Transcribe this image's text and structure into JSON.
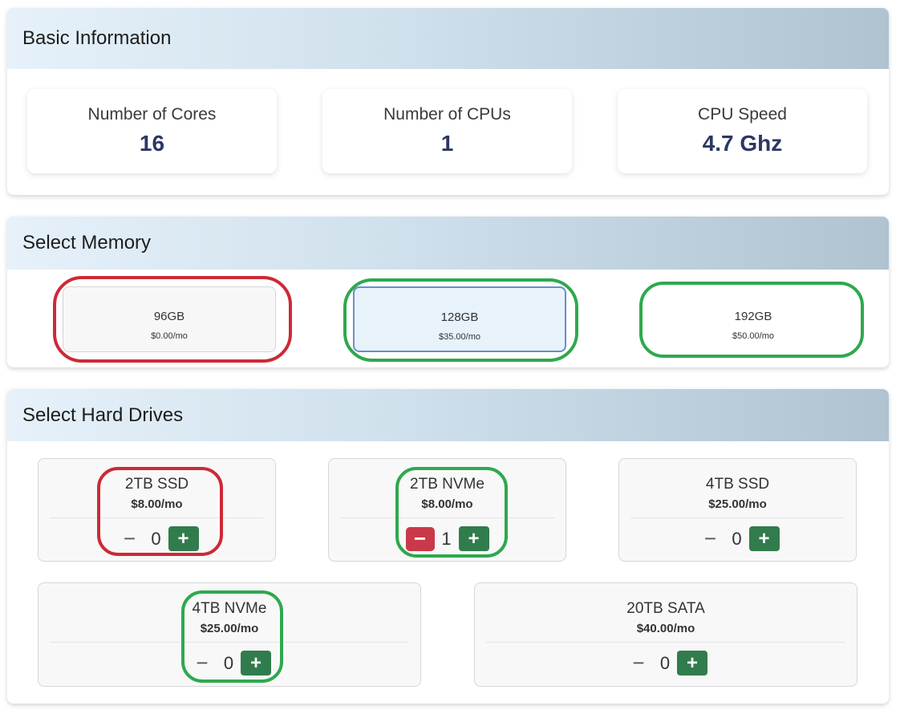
{
  "basic": {
    "title": "Basic Information",
    "cards": [
      {
        "label": "Number of Cores",
        "value": "16"
      },
      {
        "label": "Number of CPUs",
        "value": "1"
      },
      {
        "label": "CPU Speed",
        "value": "4.7 Ghz"
      }
    ]
  },
  "memory": {
    "title": "Select Memory",
    "options": [
      {
        "size": "96GB",
        "price": "$0.00/mo",
        "selected": false,
        "outline": "red"
      },
      {
        "size": "128GB",
        "price": "$35.00/mo",
        "selected": true,
        "outline": "green"
      },
      {
        "size": "192GB",
        "price": "$50.00/mo",
        "selected": false,
        "outline": "green"
      }
    ]
  },
  "drives": {
    "title": "Select Hard Drives",
    "items": [
      {
        "name": "2TB SSD",
        "price": "$8.00/mo",
        "count": "0",
        "outline": "red"
      },
      {
        "name": "2TB NVMe",
        "price": "$8.00/mo",
        "count": "1",
        "outline": "green"
      },
      {
        "name": "4TB SSD",
        "price": "$25.00/mo",
        "count": "0",
        "outline": "none"
      },
      {
        "name": "4TB NVMe",
        "price": "$25.00/mo",
        "count": "0",
        "outline": "green"
      },
      {
        "name": "20TB SATA",
        "price": "$40.00/mo",
        "count": "0",
        "outline": "none"
      }
    ],
    "minus_glyph": "−",
    "plus_glyph": "+"
  },
  "colors": {
    "value_text": "#2c3766",
    "plus_button": "#317c4c",
    "minus_active": "#c9394a",
    "outline_red": "#cc2a36",
    "outline_green": "#2fa84e"
  }
}
